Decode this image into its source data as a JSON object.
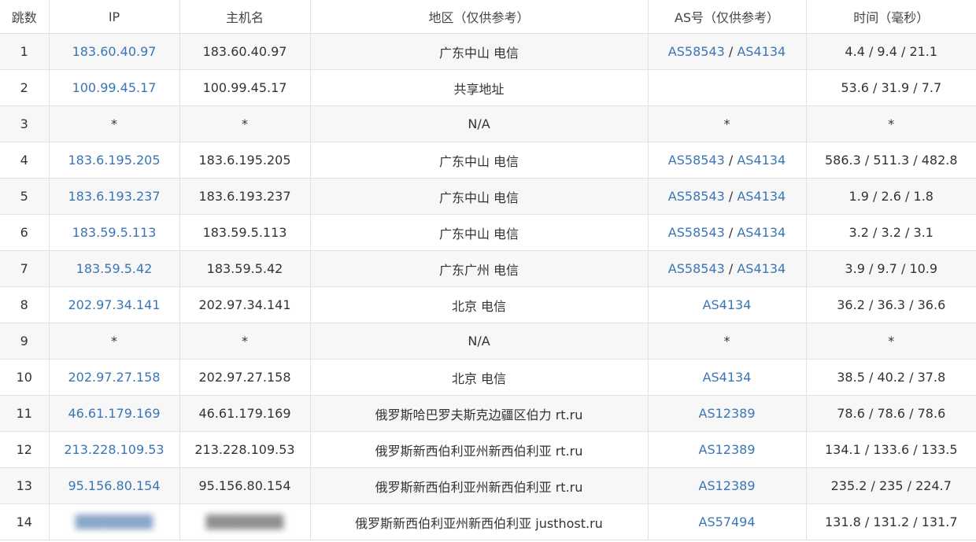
{
  "headers": [
    "跳数",
    "IP",
    "主机名",
    "地区（仅供参考）",
    "AS号（仅供参考）",
    "时间（毫秒）"
  ],
  "rows": [
    {
      "hop": "1",
      "ip": "183.60.40.97",
      "host": "183.60.40.97",
      "region": "广东中山 电信",
      "as": [
        "AS58543",
        "AS4134"
      ],
      "time": "4.4 / 9.4 / 21.1"
    },
    {
      "hop": "2",
      "ip": "100.99.45.17",
      "host": "100.99.45.17",
      "region": "共享地址",
      "as": [],
      "time": "53.6 / 31.9 / 7.7"
    },
    {
      "hop": "3",
      "ip": "*",
      "host": "*",
      "region": "N/A",
      "as_text": "*",
      "time": "*"
    },
    {
      "hop": "4",
      "ip": "183.6.195.205",
      "host": "183.6.195.205",
      "region": "广东中山 电信",
      "as": [
        "AS58543",
        "AS4134"
      ],
      "time": "586.3 / 511.3 / 482.8"
    },
    {
      "hop": "5",
      "ip": "183.6.193.237",
      "host": "183.6.193.237",
      "region": "广东中山 电信",
      "as": [
        "AS58543",
        "AS4134"
      ],
      "time": "1.9 / 2.6 / 1.8"
    },
    {
      "hop": "6",
      "ip": "183.59.5.113",
      "host": "183.59.5.113",
      "region": "广东中山 电信",
      "as": [
        "AS58543",
        "AS4134"
      ],
      "time": "3.2 / 3.2 / 3.1"
    },
    {
      "hop": "7",
      "ip": "183.59.5.42",
      "host": "183.59.5.42",
      "region": "广东广州 电信",
      "as": [
        "AS58543",
        "AS4134"
      ],
      "time": "3.9 / 9.7 / 10.9"
    },
    {
      "hop": "8",
      "ip": "202.97.34.141",
      "host": "202.97.34.141",
      "region": "北京 电信",
      "as": [
        "AS4134"
      ],
      "time": "36.2 / 36.3 / 36.6"
    },
    {
      "hop": "9",
      "ip": "*",
      "host": "*",
      "region": "N/A",
      "as_text": "*",
      "time": "*"
    },
    {
      "hop": "10",
      "ip": "202.97.27.158",
      "host": "202.97.27.158",
      "region": "北京 电信",
      "as": [
        "AS4134"
      ],
      "time": "38.5 / 40.2 / 37.8"
    },
    {
      "hop": "11",
      "ip": "46.61.179.169",
      "host": "46.61.179.169",
      "region": "俄罗斯哈巴罗夫斯克边疆区伯力 rt.ru",
      "as": [
        "AS12389"
      ],
      "time": "78.6 / 78.6 / 78.6"
    },
    {
      "hop": "12",
      "ip": "213.228.109.53",
      "host": "213.228.109.53",
      "region": "俄罗斯新西伯利亚州新西伯利亚 rt.ru",
      "as": [
        "AS12389"
      ],
      "time": "134.1 / 133.6 / 133.5"
    },
    {
      "hop": "13",
      "ip": "95.156.80.154",
      "host": "95.156.80.154",
      "region": "俄罗斯新西伯利亚州新西伯利亚 rt.ru",
      "as": [
        "AS12389"
      ],
      "time": "235.2 / 235 / 224.7"
    },
    {
      "hop": "14",
      "ip": "",
      "host": "",
      "region": "俄罗斯新西伯利亚州新西伯利亚 justhost.ru",
      "as": [
        "AS57494"
      ],
      "time": "131.8 / 131.2 / 131.7",
      "redacted": true
    }
  ],
  "colors": {
    "link": "#3a76b5",
    "stripe": "#f7f7f7",
    "border": "#e3e3e3",
    "text": "#333333"
  },
  "as_separator": " / "
}
